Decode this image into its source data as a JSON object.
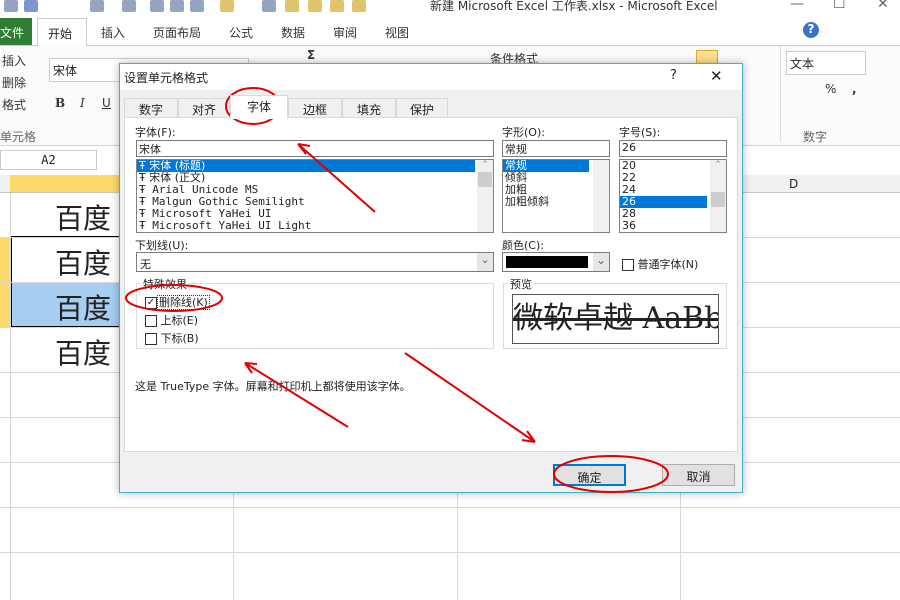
{
  "window": {
    "title": "新建 Microsoft Excel 工作表.xlsx - Microsoft Excel",
    "minimize": "—",
    "maximize": "☐",
    "close": "✕"
  },
  "ribbon_tabs": {
    "file": "文件",
    "home": "开始",
    "insert": "插入",
    "page_layout": "页面布局",
    "formulas": "公式",
    "data": "数据",
    "review": "审阅",
    "view": "视图"
  },
  "ribbon": {
    "cells_insert": "插入",
    "cells_delete": "删除",
    "cells_format": "格式",
    "cells_group": "单元格",
    "font_name": "宋体",
    "bold": "B",
    "italic": "I",
    "underline": "U",
    "sum": "Σ",
    "conditional_format": "条件格式",
    "number_format": "文本",
    "percent": "%",
    "comma": ",",
    "number_group": "数字",
    "help": "?"
  },
  "name_box": "A2",
  "columns": [
    "D"
  ],
  "cells": [
    "百度",
    "百度",
    "百度",
    "百度"
  ],
  "dialog": {
    "title": "设置单元格格式",
    "help": "?",
    "close": "✕",
    "tabs": [
      "数字",
      "对齐",
      "字体",
      "边框",
      "填充",
      "保护"
    ],
    "active_tab": "字体",
    "font_label": "字体(F):",
    "font_value": "宋体",
    "fonts": [
      "宋体 (标题)",
      "宋体 (正文)",
      "Arial Unicode MS",
      "Malgun Gothic Semilight",
      "Microsoft YaHei UI",
      "Microsoft YaHei UI Light"
    ],
    "style_label": "字形(O):",
    "style_value": "常规",
    "styles": [
      "常规",
      "倾斜",
      "加粗",
      "加粗倾斜"
    ],
    "size_label": "字号(S):",
    "size_value": "26",
    "sizes": [
      "20",
      "22",
      "24",
      "26",
      "28",
      "36"
    ],
    "underline_label": "下划线(U):",
    "underline_value": "无",
    "color_label": "颜色(C):",
    "color_value": "#000000",
    "normal_font": "普通字体(N)",
    "effects_label": "特殊效果",
    "strikethrough": "删除线(K)",
    "superscript": "上标(E)",
    "subscript": "下标(B)",
    "strikethrough_checked": true,
    "preview_label": "预览",
    "preview_text": "微软卓越  AaBbCc",
    "info": "这是 TrueType 字体。屏幕和打印机上都将使用该字体。",
    "ok": "确定",
    "cancel": "取消"
  },
  "colors": {
    "accent": "#0078d7",
    "annotation": "#e00000",
    "file_tab": "#2f7d32"
  }
}
